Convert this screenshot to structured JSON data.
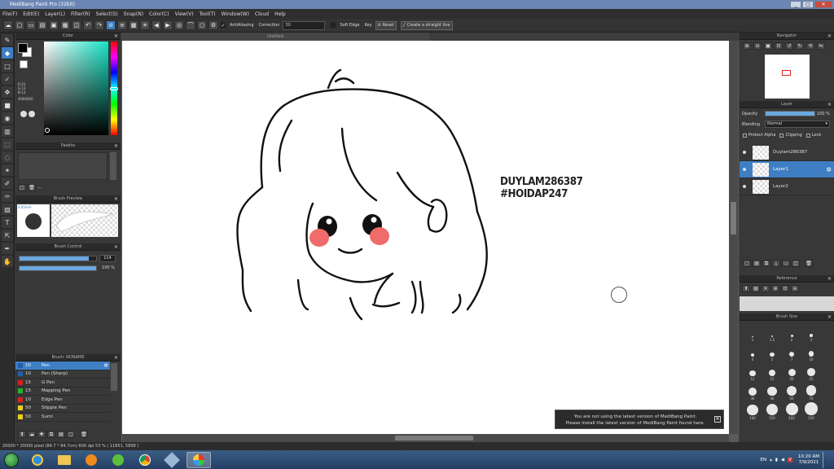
{
  "app": {
    "title": "MediBang Paint Pro (32bit)"
  },
  "window_buttons": {
    "minimize": "_",
    "maximize": "□",
    "close": "✕"
  },
  "menu": [
    "File(F)",
    "Edit(E)",
    "Layer(L)",
    "Filter(R)",
    "Select(S)",
    "Snap(N)",
    "Color(C)",
    "View(V)",
    "Tool(T)",
    "Window(W)",
    "Cloud",
    "Help"
  ],
  "toolbar": {
    "antialiasing": "AntiAliasing",
    "correction_label": "Correction",
    "correction_value": "30",
    "soft_edge": "Soft Edge",
    "key": "Key",
    "reset": "Reset",
    "straight_line": "Create a straight line"
  },
  "color_panel": {
    "title": "Color",
    "r": "R:33",
    "g": "G:12",
    "b": "B:13",
    "hex": "#000000",
    "fg_color": "#000000",
    "bg_color": "#ffffff"
  },
  "palette_panel": {
    "title": "Palette",
    "dash": "---"
  },
  "brush_preview": {
    "title": "Brush Preview",
    "size": "4.85mm"
  },
  "brush_control": {
    "title": "Brush Control",
    "size_value": "114",
    "opacity_value": "100 %",
    "size_fill": 0.9,
    "opacity_fill": 1.0
  },
  "brush_list": {
    "title": "Brush: NONAME",
    "items": [
      {
        "size": "10",
        "name": "Pen",
        "color": "#1e5fa8"
      },
      {
        "size": "10",
        "name": "Pen (Sharp)",
        "color": "#1e5fa8"
      },
      {
        "size": "15",
        "name": "G Pen",
        "color": "#d82020"
      },
      {
        "size": "15",
        "name": "Mapping Pen",
        "color": "#2ab02a"
      },
      {
        "size": "10",
        "name": "Edge Pen",
        "color": "#d82020"
      },
      {
        "size": "50",
        "name": "Stipple Pen",
        "color": "#e8d020"
      },
      {
        "size": "50",
        "name": "Sumi",
        "color": "#e8d020"
      }
    ]
  },
  "document": {
    "tab": "Untitled"
  },
  "watermark": {
    "line1": "DUYLAM286387",
    "line2": "#HOIDAP247"
  },
  "notice": {
    "line1": "You are not using the latest version of MediBang Paint.",
    "line2": "Please install the latest version of MediBang Paint found here."
  },
  "navigator": {
    "title": "Navigator"
  },
  "layer_panel": {
    "title": "Layer",
    "opacity_label": "Opacity",
    "opacity_value": "100 %",
    "opacity_fill": 1.0,
    "blending_label": "Blending",
    "blending_value": "Normal",
    "protect_alpha": "Protect Alpha",
    "clipping": "Clipping",
    "lock": "Lock",
    "layers": [
      {
        "name": "Duylam286387"
      },
      {
        "name": "Layer1"
      },
      {
        "name": "Layer2"
      }
    ]
  },
  "reference": {
    "title": "Reference"
  },
  "brush_size": {
    "title": "Brush Size",
    "sizes": [
      "1",
      "1.5",
      "2",
      "3",
      "4",
      "5",
      "7",
      "10",
      "12",
      "15",
      "20",
      "25",
      "30",
      "40",
      "50",
      "70",
      "100",
      "150",
      "200",
      "250"
    ]
  },
  "status": {
    "text": "20000 * 20000 pixel  (84.7 * 84.7cm)  600 dpi  53 %  ( 11651, 5898 )"
  },
  "taskbar": {
    "lang": "EN",
    "time": "10:20 AM",
    "date": "7/9/2021"
  }
}
